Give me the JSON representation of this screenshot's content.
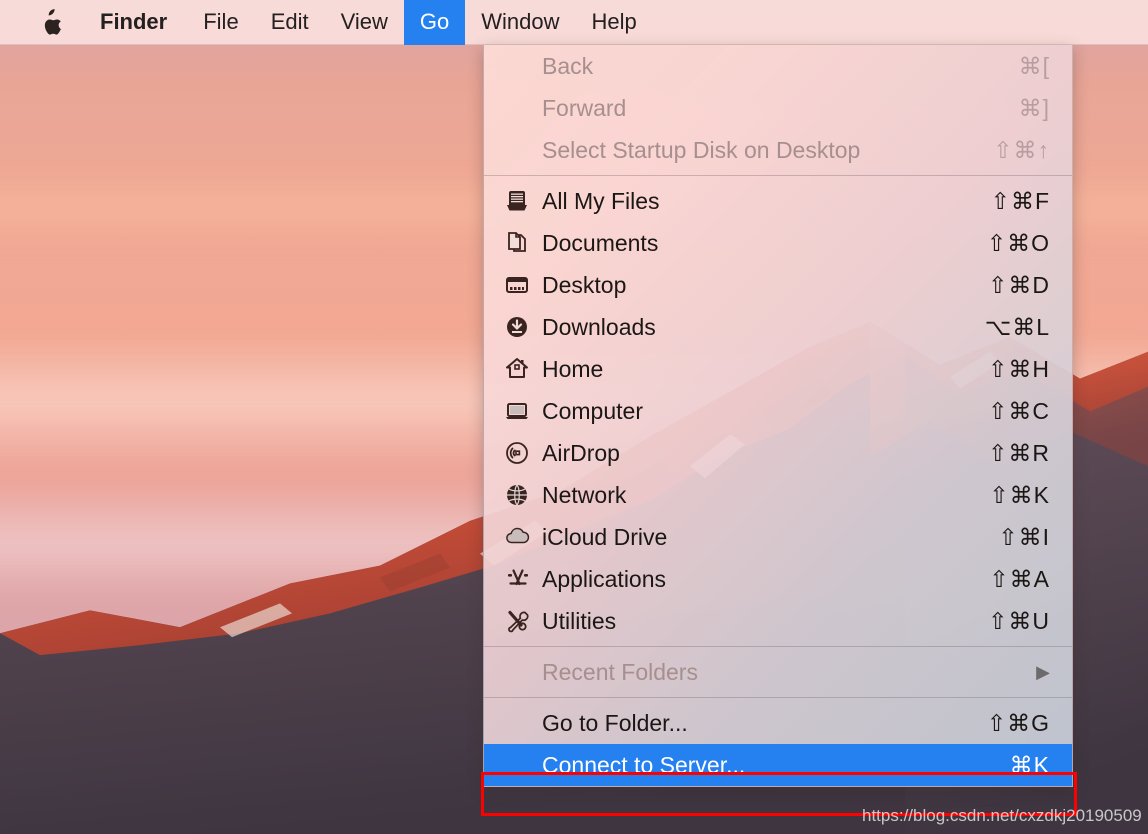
{
  "menubar": {
    "apple_icon": "apple-logo-icon",
    "items": [
      {
        "label": "Finder",
        "bold": true,
        "active": false
      },
      {
        "label": "File",
        "bold": false,
        "active": false
      },
      {
        "label": "Edit",
        "bold": false,
        "active": false
      },
      {
        "label": "View",
        "bold": false,
        "active": false
      },
      {
        "label": "Go",
        "bold": false,
        "active": true
      },
      {
        "label": "Window",
        "bold": false,
        "active": false
      },
      {
        "label": "Help",
        "bold": false,
        "active": false
      }
    ],
    "highlight_color": "#2580f0",
    "background_color": "#fae0dc"
  },
  "go_menu": {
    "groups": [
      {
        "items": [
          {
            "name": "back",
            "label": "Back",
            "shortcut": "⌘[",
            "icon": null,
            "disabled": true,
            "selected": false
          },
          {
            "name": "forward",
            "label": "Forward",
            "shortcut": "⌘]",
            "icon": null,
            "disabled": true,
            "selected": false
          },
          {
            "name": "select-startup-disk",
            "label": "Select Startup Disk on Desktop",
            "shortcut": "⇧⌘↑",
            "icon": null,
            "disabled": true,
            "selected": false
          }
        ]
      },
      {
        "items": [
          {
            "name": "all-my-files",
            "label": "All My Files",
            "shortcut": "⇧⌘F",
            "icon": "all-my-files-icon",
            "disabled": false,
            "selected": false
          },
          {
            "name": "documents",
            "label": "Documents",
            "shortcut": "⇧⌘O",
            "icon": "documents-icon",
            "disabled": false,
            "selected": false
          },
          {
            "name": "desktop",
            "label": "Desktop",
            "shortcut": "⇧⌘D",
            "icon": "desktop-icon",
            "disabled": false,
            "selected": false
          },
          {
            "name": "downloads",
            "label": "Downloads",
            "shortcut": "⌥⌘L",
            "icon": "downloads-icon",
            "disabled": false,
            "selected": false
          },
          {
            "name": "home",
            "label": "Home",
            "shortcut": "⇧⌘H",
            "icon": "home-icon",
            "disabled": false,
            "selected": false
          },
          {
            "name": "computer",
            "label": "Computer",
            "shortcut": "⇧⌘C",
            "icon": "computer-icon",
            "disabled": false,
            "selected": false
          },
          {
            "name": "airdrop",
            "label": "AirDrop",
            "shortcut": "⇧⌘R",
            "icon": "airdrop-icon",
            "disabled": false,
            "selected": false
          },
          {
            "name": "network",
            "label": "Network",
            "shortcut": "⇧⌘K",
            "icon": "network-icon",
            "disabled": false,
            "selected": false
          },
          {
            "name": "icloud-drive",
            "label": "iCloud Drive",
            "shortcut": "⇧⌘I",
            "icon": "icloud-icon",
            "disabled": false,
            "selected": false
          },
          {
            "name": "applications",
            "label": "Applications",
            "shortcut": "⇧⌘A",
            "icon": "applications-icon",
            "disabled": false,
            "selected": false
          },
          {
            "name": "utilities",
            "label": "Utilities",
            "shortcut": "⇧⌘U",
            "icon": "utilities-icon",
            "disabled": false,
            "selected": false
          }
        ]
      },
      {
        "items": [
          {
            "name": "recent-folders",
            "label": "Recent Folders",
            "shortcut": null,
            "icon": null,
            "disabled": true,
            "selected": false,
            "submenu_arrow": "▶"
          }
        ]
      },
      {
        "items": [
          {
            "name": "go-to-folder",
            "label": "Go to Folder...",
            "shortcut": "⇧⌘G",
            "icon": null,
            "disabled": false,
            "selected": false
          },
          {
            "name": "connect-to-server",
            "label": "Connect to Server...",
            "shortcut": "⌘K",
            "icon": null,
            "disabled": false,
            "selected": true
          }
        ]
      }
    ],
    "selected_color": "#2580f0",
    "annotation_color": "#ff0000"
  },
  "watermark": {
    "text": "https://blog.csdn.net/cxzdkj20190509"
  }
}
